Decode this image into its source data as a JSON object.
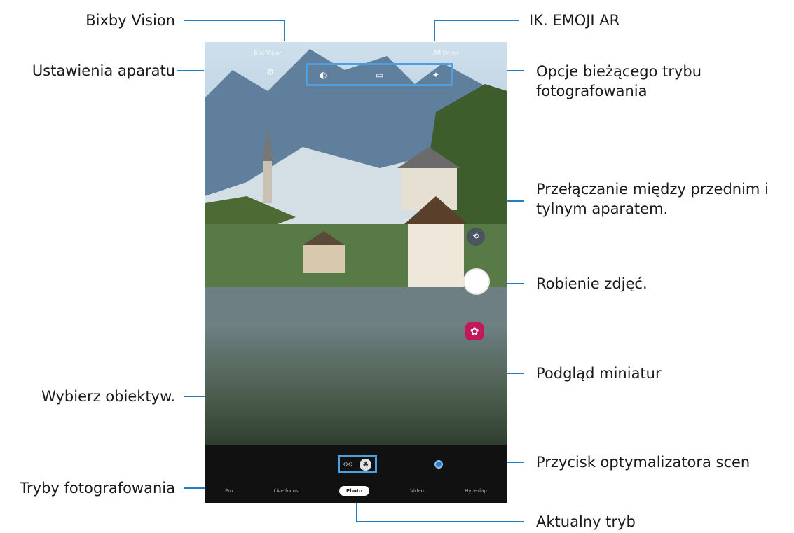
{
  "callouts": {
    "bixby_vision": "Bixby Vision",
    "settings": "Ustawienia aparatu",
    "emoji": "IK. EMOJI AR",
    "current_mode_options": "Opcje bieżącego trybu fotografowania",
    "switch_camera": "Przełączanie między przednim i tylnym aparatem.",
    "take_photo": "Robienie zdjęć.",
    "thumbnail": "Podgląd miniatur",
    "select_lens": "Wybierz obiektyw.",
    "scene_optimizer": "Przycisk optymalizatora scen",
    "shooting_modes": "Tryby fotografowania",
    "current_mode": "Aktualny tryb"
  },
  "screen": {
    "top": {
      "left_label": "B ai Vision",
      "right_label": "AR Emoji"
    },
    "icons": {
      "settings": "gear-icon",
      "options": [
        "hdr-icon",
        "ratio-icon",
        "filter-icon"
      ],
      "switch": "camera-switch-icon",
      "thumbnail": "flower-icon",
      "lens_wide": "wide-lens-icon",
      "lens_normal": "tree-icon"
    },
    "modes": [
      "Pro",
      "Live focus",
      "Photo",
      "Video",
      "Hyperlap"
    ],
    "active_mode": "Photo"
  },
  "colors": {
    "accent": "#4aa0e0",
    "thumbnail": "#c2185b",
    "scene": "#2b7fc7"
  }
}
